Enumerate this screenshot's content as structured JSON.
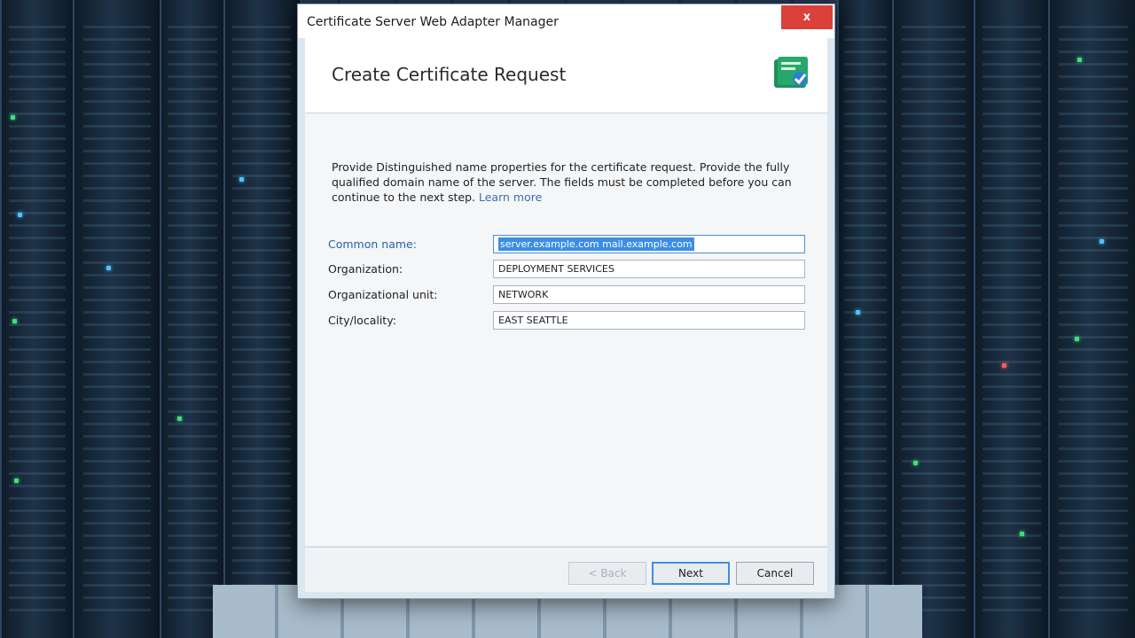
{
  "window": {
    "title": "Certificate Server Web Adapter Manager",
    "close_label": "x"
  },
  "header": {
    "heading": "Create Certificate Request",
    "icon": "certificate-icon"
  },
  "description": {
    "text": "Provide Distinguished name properties for the certificate request. Provide the fully qualified domain name of the server. The fields must be completed before you can continue to the next step.",
    "link": "Learn more"
  },
  "form": {
    "fields": [
      {
        "label": "Common name:",
        "value": "server.example.com  mail.example.com"
      },
      {
        "label": "Organization:",
        "value": "DEPLOYMENT SERVICES"
      },
      {
        "label": "Organizational unit:",
        "value": "NETWORK"
      },
      {
        "label": "City/locality:",
        "value": "EAST SEATTLE"
      }
    ]
  },
  "footer": {
    "previous_label": "< Back",
    "next_label": "Next",
    "cancel_label": "Cancel"
  },
  "colors": {
    "accent": "#3b8ee6",
    "close": "#d9413a"
  }
}
